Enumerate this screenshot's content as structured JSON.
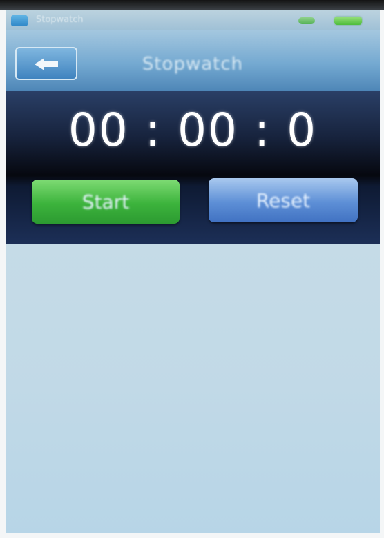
{
  "status_bar": {
    "carrier_text": "Stopwatch"
  },
  "title_bar": {
    "title": "Stopwatch"
  },
  "timer": {
    "display": "00 : 00 : 0"
  },
  "controls": {
    "start_label": "Start",
    "reset_label": "Reset"
  },
  "colors": {
    "start_button": "#3cb33c",
    "reset_button": "#5d8fd6",
    "timer_panel": "#0e1a33",
    "title_bar": "#74a9d1"
  },
  "icons": {
    "back": "back-arrow-icon",
    "battery": "battery-icon",
    "signal": "signal-icon"
  }
}
